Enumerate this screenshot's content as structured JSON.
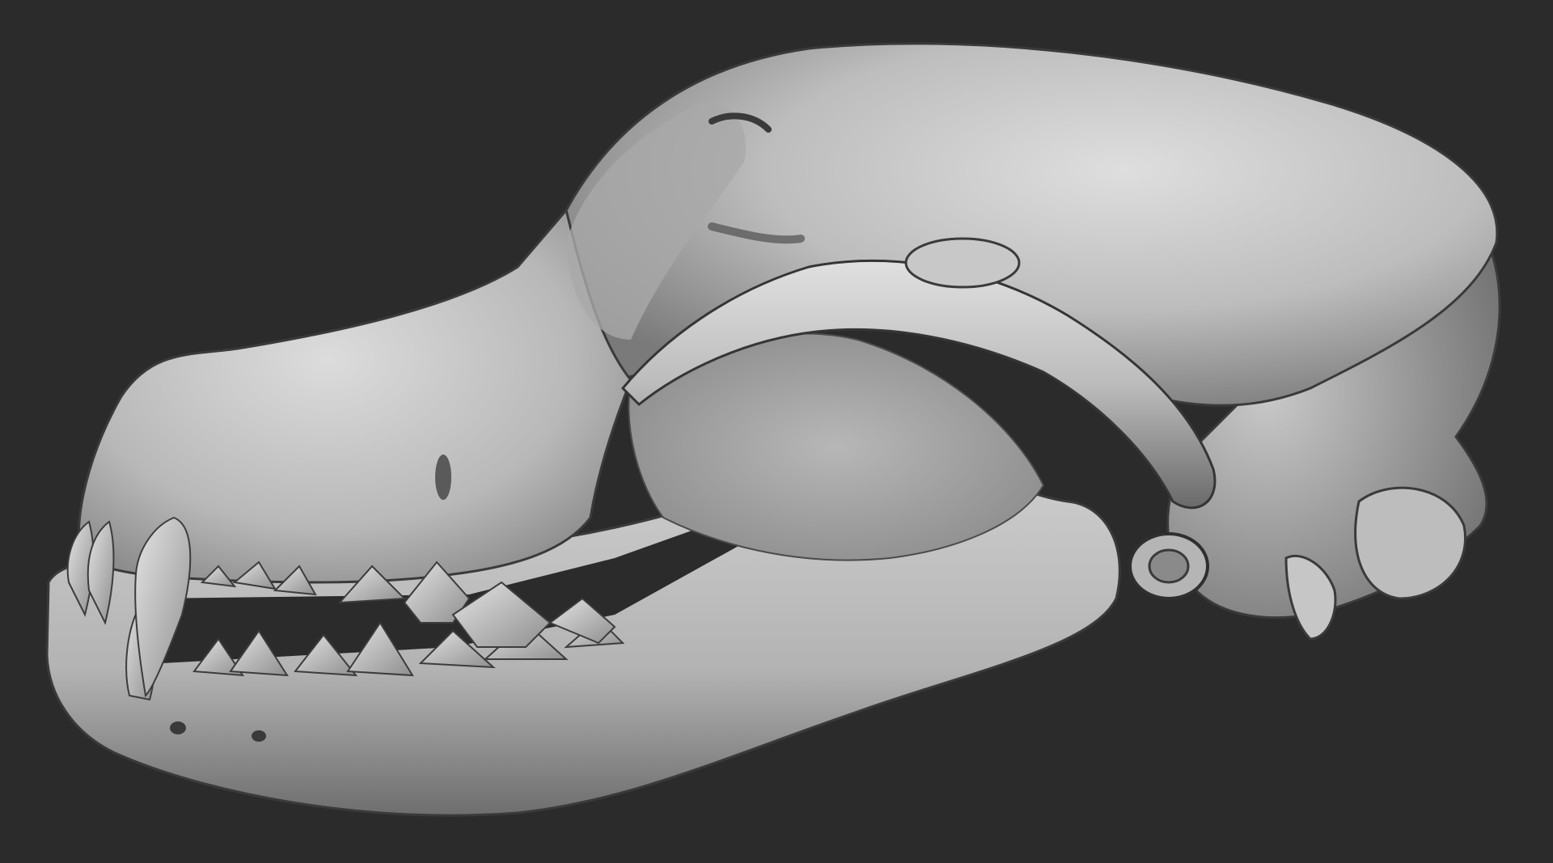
{
  "scene": {
    "background_color": "#2b2b2b",
    "bone_highlight_color": "#d9d9d9",
    "bone_mid_color": "#a6a6a6",
    "bone_shadow_color": "#5a5a5a",
    "subject": "dog-skull-3d-sculpt"
  }
}
